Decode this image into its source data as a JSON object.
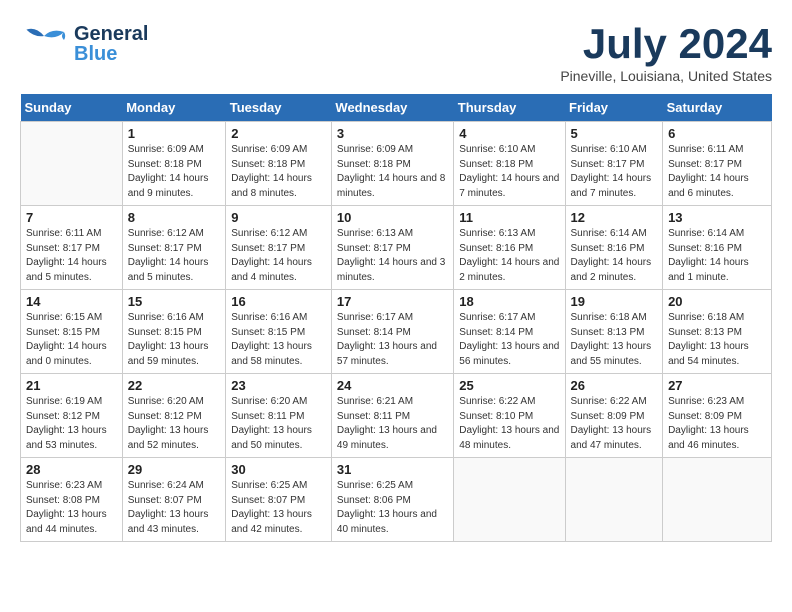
{
  "header": {
    "logo": {
      "general": "General",
      "blue": "Blue"
    },
    "title": "July 2024",
    "location": "Pineville, Louisiana, United States"
  },
  "days_of_week": [
    "Sunday",
    "Monday",
    "Tuesday",
    "Wednesday",
    "Thursday",
    "Friday",
    "Saturday"
  ],
  "weeks": [
    [
      {
        "day": "",
        "info": ""
      },
      {
        "day": "1",
        "info": "Sunrise: 6:09 AM\nSunset: 8:18 PM\nDaylight: 14 hours\nand 9 minutes."
      },
      {
        "day": "2",
        "info": "Sunrise: 6:09 AM\nSunset: 8:18 PM\nDaylight: 14 hours\nand 8 minutes."
      },
      {
        "day": "3",
        "info": "Sunrise: 6:09 AM\nSunset: 8:18 PM\nDaylight: 14 hours\nand 8 minutes."
      },
      {
        "day": "4",
        "info": "Sunrise: 6:10 AM\nSunset: 8:18 PM\nDaylight: 14 hours\nand 7 minutes."
      },
      {
        "day": "5",
        "info": "Sunrise: 6:10 AM\nSunset: 8:17 PM\nDaylight: 14 hours\nand 7 minutes."
      },
      {
        "day": "6",
        "info": "Sunrise: 6:11 AM\nSunset: 8:17 PM\nDaylight: 14 hours\nand 6 minutes."
      }
    ],
    [
      {
        "day": "7",
        "info": "Sunrise: 6:11 AM\nSunset: 8:17 PM\nDaylight: 14 hours\nand 5 minutes."
      },
      {
        "day": "8",
        "info": "Sunrise: 6:12 AM\nSunset: 8:17 PM\nDaylight: 14 hours\nand 5 minutes."
      },
      {
        "day": "9",
        "info": "Sunrise: 6:12 AM\nSunset: 8:17 PM\nDaylight: 14 hours\nand 4 minutes."
      },
      {
        "day": "10",
        "info": "Sunrise: 6:13 AM\nSunset: 8:17 PM\nDaylight: 14 hours\nand 3 minutes."
      },
      {
        "day": "11",
        "info": "Sunrise: 6:13 AM\nSunset: 8:16 PM\nDaylight: 14 hours\nand 2 minutes."
      },
      {
        "day": "12",
        "info": "Sunrise: 6:14 AM\nSunset: 8:16 PM\nDaylight: 14 hours\nand 2 minutes."
      },
      {
        "day": "13",
        "info": "Sunrise: 6:14 AM\nSunset: 8:16 PM\nDaylight: 14 hours\nand 1 minute."
      }
    ],
    [
      {
        "day": "14",
        "info": "Sunrise: 6:15 AM\nSunset: 8:15 PM\nDaylight: 14 hours\nand 0 minutes."
      },
      {
        "day": "15",
        "info": "Sunrise: 6:16 AM\nSunset: 8:15 PM\nDaylight: 13 hours\nand 59 minutes."
      },
      {
        "day": "16",
        "info": "Sunrise: 6:16 AM\nSunset: 8:15 PM\nDaylight: 13 hours\nand 58 minutes."
      },
      {
        "day": "17",
        "info": "Sunrise: 6:17 AM\nSunset: 8:14 PM\nDaylight: 13 hours\nand 57 minutes."
      },
      {
        "day": "18",
        "info": "Sunrise: 6:17 AM\nSunset: 8:14 PM\nDaylight: 13 hours\nand 56 minutes."
      },
      {
        "day": "19",
        "info": "Sunrise: 6:18 AM\nSunset: 8:13 PM\nDaylight: 13 hours\nand 55 minutes."
      },
      {
        "day": "20",
        "info": "Sunrise: 6:18 AM\nSunset: 8:13 PM\nDaylight: 13 hours\nand 54 minutes."
      }
    ],
    [
      {
        "day": "21",
        "info": "Sunrise: 6:19 AM\nSunset: 8:12 PM\nDaylight: 13 hours\nand 53 minutes."
      },
      {
        "day": "22",
        "info": "Sunrise: 6:20 AM\nSunset: 8:12 PM\nDaylight: 13 hours\nand 52 minutes."
      },
      {
        "day": "23",
        "info": "Sunrise: 6:20 AM\nSunset: 8:11 PM\nDaylight: 13 hours\nand 50 minutes."
      },
      {
        "day": "24",
        "info": "Sunrise: 6:21 AM\nSunset: 8:11 PM\nDaylight: 13 hours\nand 49 minutes."
      },
      {
        "day": "25",
        "info": "Sunrise: 6:22 AM\nSunset: 8:10 PM\nDaylight: 13 hours\nand 48 minutes."
      },
      {
        "day": "26",
        "info": "Sunrise: 6:22 AM\nSunset: 8:09 PM\nDaylight: 13 hours\nand 47 minutes."
      },
      {
        "day": "27",
        "info": "Sunrise: 6:23 AM\nSunset: 8:09 PM\nDaylight: 13 hours\nand 46 minutes."
      }
    ],
    [
      {
        "day": "28",
        "info": "Sunrise: 6:23 AM\nSunset: 8:08 PM\nDaylight: 13 hours\nand 44 minutes."
      },
      {
        "day": "29",
        "info": "Sunrise: 6:24 AM\nSunset: 8:07 PM\nDaylight: 13 hours\nand 43 minutes."
      },
      {
        "day": "30",
        "info": "Sunrise: 6:25 AM\nSunset: 8:07 PM\nDaylight: 13 hours\nand 42 minutes."
      },
      {
        "day": "31",
        "info": "Sunrise: 6:25 AM\nSunset: 8:06 PM\nDaylight: 13 hours\nand 40 minutes."
      },
      {
        "day": "",
        "info": ""
      },
      {
        "day": "",
        "info": ""
      },
      {
        "day": "",
        "info": ""
      }
    ]
  ]
}
